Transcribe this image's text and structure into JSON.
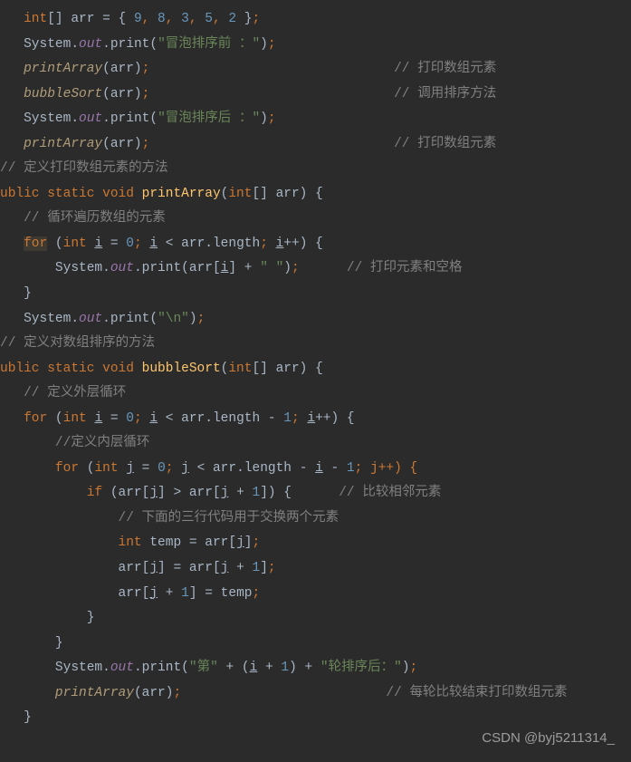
{
  "code": {
    "l1_a": "int",
    "l1_b": "[] arr = { ",
    "l1_n1": "9",
    "l1_c": ", ",
    "l1_n2": "8",
    "l1_n3": "3",
    "l1_n4": "5",
    "l1_n5": "2",
    "l1_d": " }",
    "l1_e": ";",
    "l2_a": "System.",
    "l2_b": "out",
    "l2_c": ".print(",
    "l2_d": "\"冒泡排序前 ：\"",
    "l2_e": ")",
    "l2_f": ";",
    "l3_a": "printArray",
    "l3_b": "(arr)",
    "l3_c": ";",
    "l3_com": "// 打印数组元素",
    "l4_a": "bubbleSort",
    "l4_b": "(arr)",
    "l4_c": ";",
    "l4_com": "// 调用排序方法",
    "l5_a": "System.",
    "l5_b": "out",
    "l5_c": ".print(",
    "l5_d": "\"冒泡排序后 ：\"",
    "l5_e": ")",
    "l5_f": ";",
    "l6_a": "printArray",
    "l6_b": "(arr)",
    "l6_c": ";",
    "l6_com": "// 打印数组元素",
    "l7_com": "// 定义打印数组元素的方法",
    "l8_a": "ublic static void ",
    "l8_b": "printArray",
    "l8_c": "(",
    "l8_d": "int",
    "l8_e": "[] arr) {",
    "l9_com": "// 循环遍历数组的元素",
    "l10_a": "for",
    "l10_b": " (",
    "l10_c": "int ",
    "l10_d": "i",
    "l10_e": " = ",
    "l10_n": "0",
    "l10_f": "; ",
    "l10_g": "i",
    "l10_h": " < arr.length",
    "l10_i": "; ",
    "l10_j": "i",
    "l10_k": "++) {",
    "l11_a": "System.",
    "l11_b": "out",
    "l11_c": ".print(arr[",
    "l11_d": "i",
    "l11_e": "] + ",
    "l11_f": "\" \"",
    "l11_g": ")",
    "l11_h": ";",
    "l11_com": "// 打印元素和空格",
    "l12_a": "}",
    "l13_a": "System.",
    "l13_b": "out",
    "l13_c": ".print(",
    "l13_d": "\"\\n\"",
    "l13_e": ")",
    "l13_f": ";",
    "l14_com": "// 定义对数组排序的方法",
    "l15_a": "ublic static void ",
    "l15_b": "bubbleSort",
    "l15_c": "(",
    "l15_d": "int",
    "l15_e": "[] arr) {",
    "l16_com": "// 定义外层循环",
    "l17_a": "for ",
    "l17_b": "(",
    "l17_c": "int ",
    "l17_d": "i",
    "l17_e": " = ",
    "l17_n": "0",
    "l17_f": "; ",
    "l17_g": "i",
    "l17_h": " < arr.length - ",
    "l17_n2": "1",
    "l17_i": "; ",
    "l17_j": "i",
    "l17_k": "++) {",
    "l18_com": "//定义内层循环",
    "l19_a": "for ",
    "l19_b": "(",
    "l19_c": "int ",
    "l19_d": "j",
    "l19_e": " = ",
    "l19_n": "0",
    "l19_f": "; ",
    "l19_g": "j",
    "l19_h": " < arr.length - ",
    "l19_i": "i",
    "l19_j": " - ",
    "l19_n2": "1",
    "l19_k": "; j++) {",
    "l20_a": "if ",
    "l20_b": "(arr[",
    "l20_c": "j",
    "l20_d": "] > arr[",
    "l20_e": "j",
    "l20_f": " + ",
    "l20_n": "1",
    "l20_g": "]) {",
    "l20_com": "// 比较相邻元素",
    "l21_com": "// 下面的三行代码用于交换两个元素",
    "l22_a": "int ",
    "l22_b": "temp = arr[",
    "l22_c": "j",
    "l22_d": "]",
    "l22_e": ";",
    "l23_a": "arr[",
    "l23_b": "j",
    "l23_c": "] = arr[",
    "l23_d": "j",
    "l23_e": " + ",
    "l23_n": "1",
    "l23_f": "]",
    "l23_g": ";",
    "l24_a": "arr[",
    "l24_b": "j",
    "l24_c": " + ",
    "l24_n": "1",
    "l24_d": "] = temp",
    "l24_e": ";",
    "l25_a": "}",
    "l26_a": "}",
    "l27_a": "System.",
    "l27_b": "out",
    "l27_c": ".print(",
    "l27_d": "\"第\"",
    "l27_e": " + (",
    "l27_f": "i",
    "l27_g": " + ",
    "l27_n": "1",
    "l27_h": ") + ",
    "l27_i": "\"轮排序后：\"",
    "l27_j": ")",
    "l27_k": ";",
    "l28_a": "printArray",
    "l28_b": "(arr)",
    "l28_c": ";",
    "l28_com": "// 每轮比较结束打印数组元素",
    "l29_a": "}"
  },
  "watermark": "CSDN @byj5211314_"
}
